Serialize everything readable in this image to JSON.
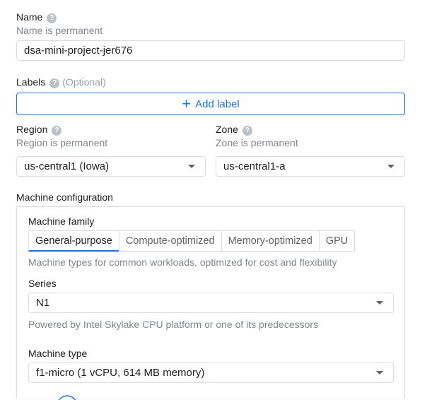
{
  "name": {
    "label": "Name",
    "hint": "Name is permanent",
    "value": "dsa-mini-project-jer676"
  },
  "labels": {
    "label": "Labels",
    "optional": "(Optional)",
    "add_button": "Add label"
  },
  "region": {
    "label": "Region",
    "hint": "Region is permanent",
    "value": "us-central1 (Iowa)"
  },
  "zone": {
    "label": "Zone",
    "hint": "Zone is permanent",
    "value": "us-central1-a"
  },
  "machine_config": {
    "title": "Machine configuration",
    "family_label": "Machine family",
    "tabs": [
      "General-purpose",
      "Compute-optimized",
      "Memory-optimized",
      "GPU"
    ],
    "active_tab": "General-purpose",
    "family_description": "Machine types for common workloads, optimized for cost and flexibility",
    "series_label": "Series",
    "series_value": "N1",
    "series_description": "Powered by Intel Skylake CPU platform or one of its predecessors",
    "type_label": "Machine type",
    "type_value": "f1-micro (1 vCPU, 614 MB memory)"
  },
  "icons": {
    "help": "help-icon",
    "add": "plus-icon",
    "dropdown": "caret-down-icon"
  },
  "colors": {
    "accent": "#1a73e8",
    "border": "#dadce0",
    "muted_text": "#80868b"
  }
}
